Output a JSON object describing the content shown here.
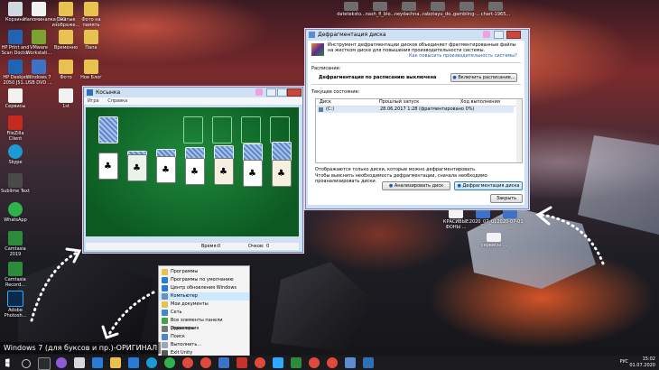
{
  "desktop": {
    "icons": [
      {
        "label": "Корзина"
      },
      {
        "label": "Напоминалка_ICO"
      },
      {
        "label": "Сжатые изображе..."
      },
      {
        "label": "Фото на память"
      },
      {
        "label": "HP Print and Scan Doctor"
      },
      {
        "label": "VMware Workstati..."
      },
      {
        "label": "Временно"
      },
      {
        "label": "Папа"
      },
      {
        "label": "HP Deskjet 2050 J51..."
      },
      {
        "label": "Windows 7 USB DVD ..."
      },
      {
        "label": "Фото"
      },
      {
        "label": "Нов Блог"
      },
      {
        "label": "Сервисы"
      },
      {
        "label": "1st"
      },
      {
        "label": "FileZilla Client"
      },
      {
        "label": "Skype"
      },
      {
        "label": "Sublime Text"
      },
      {
        "label": "WhatsApp"
      },
      {
        "label": "Camtasia 2019"
      },
      {
        "label": "Camtasia Record..."
      },
      {
        "label": "Adobe Photosh..."
      }
    ],
    "top_files": [
      {
        "label": "dateteksto..."
      },
      {
        "label": "nash_fl_blo..."
      },
      {
        "label": "neydachna..."
      },
      {
        "label": "rabotayu_do..."
      },
      {
        "label": "gambling-..."
      },
      {
        "label": "chart-1965..."
      }
    ],
    "bottom_files": [
      {
        "label": "КРАСИВЫЕ ФОНЫ ..."
      },
      {
        "label": "2020_07_01 ..."
      },
      {
        "label": "2020-07-01 ..."
      },
      {
        "label": "сервисы ..."
      }
    ],
    "banner_text": "Windows 7 (для буксов и пр.)-ОРИГИНАЛ"
  },
  "solitaire": {
    "title": "Косынка",
    "menu": [
      "Игра",
      "Справка"
    ],
    "status_time_label": "Время:",
    "status_time_value": "0",
    "status_score_label": "Очков:",
    "status_score_value": "0",
    "cards": [
      "♣",
      "♣",
      "♣",
      "♣",
      "♣",
      "♣",
      "♣"
    ]
  },
  "defrag": {
    "title": "Дефрагментация диска",
    "intro": "Инструмент дефрагментации дисков объединяет фрагментированные файлы на жестком диске для повышения производительности системы.",
    "intro_link": "Как повысить производительность системы?",
    "schedule_label": "Расписание:",
    "schedule_status": "Дефрагментация по расписанию выключена",
    "schedule_button": "Включить расписание...",
    "current_state_label": "Текущее состояние:",
    "columns": [
      "Диск",
      "Прошлый запуск",
      "Ход выполнения"
    ],
    "rows": [
      {
        "disk": "(C:)",
        "last_run": "28.06.2017 1:28 (фрагментировано 0%)",
        "progress": ""
      }
    ],
    "note1": "Отображаются только диски, которые можно дефрагментировать.",
    "note2": "Чтобы выяснить необходимость дефрагментации, сначала необходимо проанализировать диски.",
    "analyze_button": "Анализировать диск",
    "defrag_button": "Дефрагментация диска",
    "close_button": "Закрыть"
  },
  "menu": {
    "items": [
      {
        "label": "Программы"
      },
      {
        "label": "Программы по умолчанию"
      },
      {
        "label": "Центр обновления Windows"
      },
      {
        "label": "Компьютер"
      },
      {
        "label": "Мои документы"
      },
      {
        "label": "Сеть"
      },
      {
        "label": "Все элементы панели управления"
      },
      {
        "label": "Принтеры"
      },
      {
        "label": "Поиск"
      },
      {
        "label": "Выполнить..."
      },
      {
        "label": "Exit Unity"
      }
    ],
    "selected_index": 3
  },
  "taskbar": {
    "lang": "РУС",
    "time": "15:02",
    "date": "01.07.2020"
  },
  "colors": {
    "felt": "#138036",
    "selection": "#cde8ff",
    "taskbar": "#1b1b1f"
  }
}
